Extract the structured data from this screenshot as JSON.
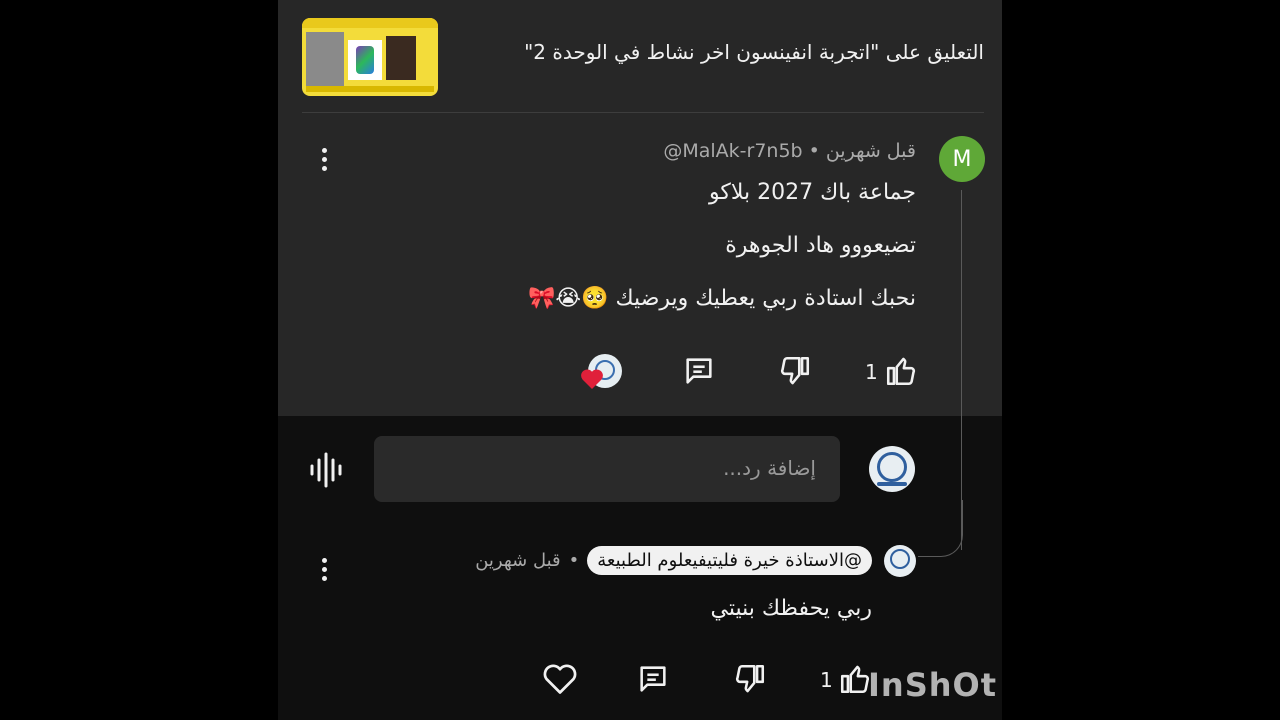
{
  "header": {
    "title": "التعليق على \"اتجربة انفينسون اخر نشاط في الوحدة 2\""
  },
  "comment": {
    "avatar_letter": "M",
    "handle": "@MalAk-r7n5b",
    "time": "قبل شهرين",
    "separator": "•",
    "lines": [
      "جماعة باك 2027 بلاكو",
      "تضيعووو هاد الجوهرة",
      "نحبك استادة ربي يعطيك ويرضيك 🥺😭🎀"
    ],
    "like_count": "1"
  },
  "reply_box": {
    "placeholder": "إضافة رد..."
  },
  "reply": {
    "handle": "@الاستاذة خيرة فليتيفيعلوم الطبيعة",
    "time": "قبل شهرين",
    "separator": "•",
    "text": "ربي يحفظك بنيتي",
    "like_count": "1"
  },
  "watermark": "InShOt",
  "colors": {
    "panel": "#272727",
    "background": "#0f0f0f",
    "avatar_green": "#5fa837",
    "heart_red": "#e0203a"
  }
}
